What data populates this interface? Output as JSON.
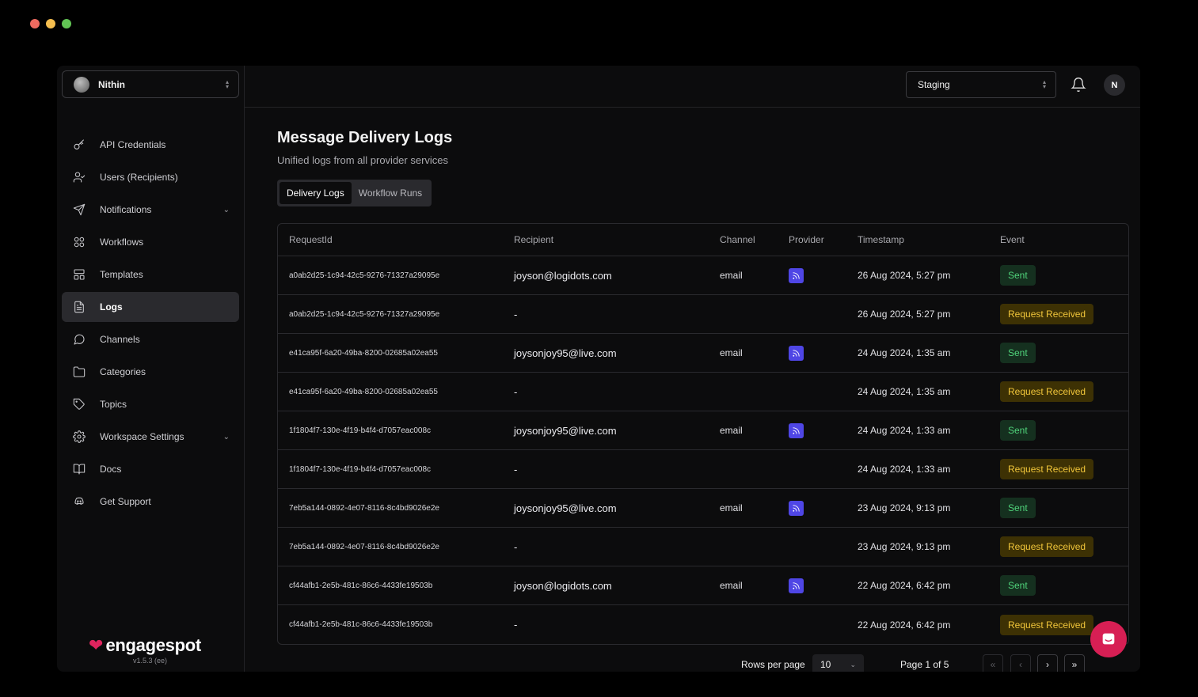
{
  "window": {
    "traffic_lights": [
      "#ee6a5f",
      "#f5be4f",
      "#62c554"
    ]
  },
  "workspace": {
    "name": "Nithin"
  },
  "sidebar": {
    "items": [
      {
        "label": "API Credentials",
        "icon": "key-icon"
      },
      {
        "label": "Users (Recipients)",
        "icon": "user-check-icon"
      },
      {
        "label": "Notifications",
        "icon": "send-icon",
        "expandable": true
      },
      {
        "label": "Workflows",
        "icon": "workflow-icon"
      },
      {
        "label": "Templates",
        "icon": "layout-icon"
      },
      {
        "label": "Logs",
        "icon": "file-text-icon",
        "active": true
      },
      {
        "label": "Channels",
        "icon": "message-circle-icon"
      },
      {
        "label": "Categories",
        "icon": "folder-icon"
      },
      {
        "label": "Topics",
        "icon": "tag-icon"
      },
      {
        "label": "Workspace Settings",
        "icon": "settings-icon",
        "expandable": true
      },
      {
        "label": "Docs",
        "icon": "book-icon"
      },
      {
        "label": "Get Support",
        "icon": "discord-icon"
      }
    ]
  },
  "brand": {
    "name": "engagespot",
    "version": "v1.5.3 (ee)",
    "color": "#e0245e"
  },
  "topbar": {
    "environment": "Staging",
    "user_initial": "N"
  },
  "page": {
    "title": "Message Delivery Logs",
    "subtitle": "Unified logs from all provider services",
    "tabs": [
      {
        "label": "Delivery Logs",
        "active": true
      },
      {
        "label": "Workflow Runs",
        "active": false
      }
    ]
  },
  "table": {
    "headers": [
      "RequestId",
      "Recipient",
      "Channel",
      "Provider",
      "Timestamp",
      "Event"
    ],
    "rows": [
      {
        "request_id": "a0ab2d25-1c94-42c5-9276-71327a29095e",
        "recipient": "joyson@logidots.com",
        "channel": "email",
        "has_provider": true,
        "timestamp": "26 Aug 2024, 5:27 pm",
        "event": "Sent"
      },
      {
        "request_id": "a0ab2d25-1c94-42c5-9276-71327a29095e",
        "recipient": "-",
        "channel": "",
        "has_provider": false,
        "timestamp": "26 Aug 2024, 5:27 pm",
        "event": "Request Received"
      },
      {
        "request_id": "e41ca95f-6a20-49ba-8200-02685a02ea55",
        "recipient": "joysonjoy95@live.com",
        "channel": "email",
        "has_provider": true,
        "timestamp": "24 Aug 2024, 1:35 am",
        "event": "Sent"
      },
      {
        "request_id": "e41ca95f-6a20-49ba-8200-02685a02ea55",
        "recipient": "-",
        "channel": "",
        "has_provider": false,
        "timestamp": "24 Aug 2024, 1:35 am",
        "event": "Request Received"
      },
      {
        "request_id": "1f1804f7-130e-4f19-b4f4-d7057eac008c",
        "recipient": "joysonjoy95@live.com",
        "channel": "email",
        "has_provider": true,
        "timestamp": "24 Aug 2024, 1:33 am",
        "event": "Sent"
      },
      {
        "request_id": "1f1804f7-130e-4f19-b4f4-d7057eac008c",
        "recipient": "-",
        "channel": "",
        "has_provider": false,
        "timestamp": "24 Aug 2024, 1:33 am",
        "event": "Request Received"
      },
      {
        "request_id": "7eb5a144-0892-4e07-8116-8c4bd9026e2e",
        "recipient": "joysonjoy95@live.com",
        "channel": "email",
        "has_provider": true,
        "timestamp": "23 Aug 2024, 9:13 pm",
        "event": "Sent"
      },
      {
        "request_id": "7eb5a144-0892-4e07-8116-8c4bd9026e2e",
        "recipient": "-",
        "channel": "",
        "has_provider": false,
        "timestamp": "23 Aug 2024, 9:13 pm",
        "event": "Request Received"
      },
      {
        "request_id": "cf44afb1-2e5b-481c-86c6-4433fe19503b",
        "recipient": "joyson@logidots.com",
        "channel": "email",
        "has_provider": true,
        "timestamp": "22 Aug 2024, 6:42 pm",
        "event": "Sent"
      },
      {
        "request_id": "cf44afb1-2e5b-481c-86c6-4433fe19503b",
        "recipient": "-",
        "channel": "",
        "has_provider": false,
        "timestamp": "22 Aug 2024, 6:42 pm",
        "event": "Request Received"
      }
    ]
  },
  "pagination": {
    "rows_per_page_label": "Rows per page",
    "rows_per_page": "10",
    "page_info": "Page 1 of 5",
    "first": "«",
    "prev": "‹",
    "next": "›",
    "last": "»"
  },
  "colors": {
    "sent_badge": "#4fd27a",
    "received_badge": "#f0c53a",
    "provider": "#4f46e5",
    "chat_button": "#d71f54"
  }
}
